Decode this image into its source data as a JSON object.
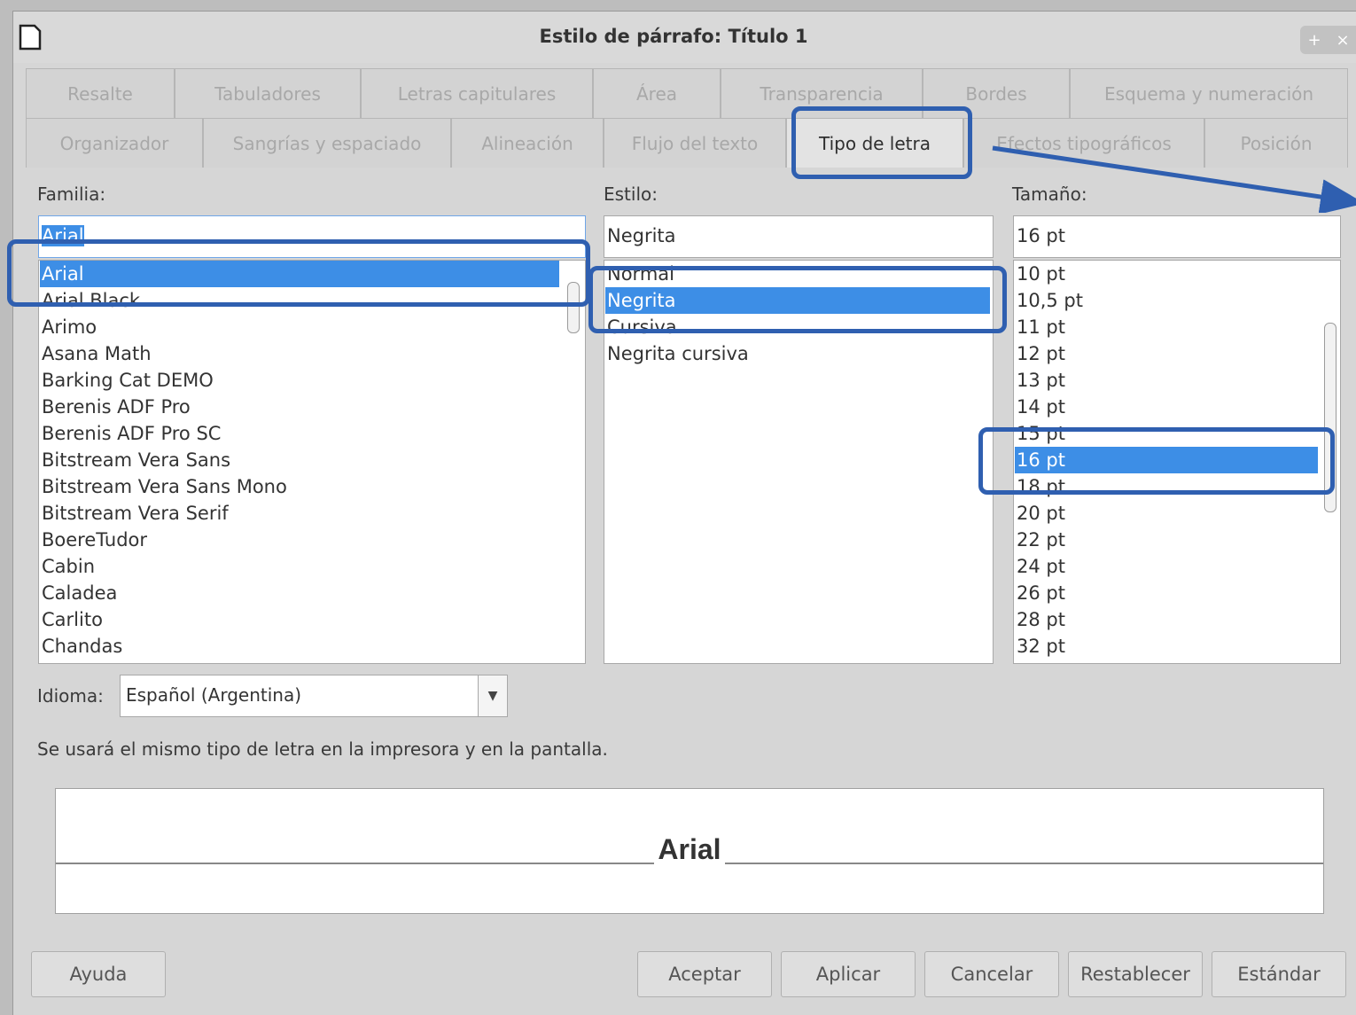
{
  "dialog": {
    "title": "Estilo de párrafo: Título 1",
    "window_buttons": [
      "+",
      "×"
    ]
  },
  "tabs_row1": [
    "Resalte",
    "Tabuladores",
    "Letras capitulares",
    "Área",
    "Transparencia",
    "Bordes",
    "Esquema y numeración"
  ],
  "tabs_row2": [
    "Organizador",
    "Sangrías y espaciado",
    "Alineación",
    "Flujo del texto",
    "Tipo de letra",
    "Efectos tipográficos",
    "Posición"
  ],
  "active_tab": "Tipo de letra",
  "family": {
    "label": "Familia:",
    "value": "Arial",
    "items": [
      "Arial",
      "Arial Black",
      "Arimo",
      "Asana Math",
      "Barking Cat DEMO",
      "Berenis ADF Pro",
      "Berenis ADF Pro SC",
      "Bitstream Vera Sans",
      "Bitstream Vera Sans Mono",
      "Bitstream Vera Serif",
      "BoereTudor",
      "Cabin",
      "Caladea",
      "Carlito",
      "Chandas"
    ],
    "selected": "Arial"
  },
  "style": {
    "label": "Estilo:",
    "value": "Negrita",
    "items": [
      "Normal",
      "Negrita",
      "Cursiva",
      "Negrita cursiva"
    ],
    "selected": "Negrita"
  },
  "size": {
    "label": "Tamaño:",
    "value": "16 pt",
    "items": [
      "10 pt",
      "10,5 pt",
      "11 pt",
      "12 pt",
      "13 pt",
      "14 pt",
      "15 pt",
      "16 pt",
      "18 pt",
      "20 pt",
      "22 pt",
      "24 pt",
      "26 pt",
      "28 pt",
      "32 pt"
    ],
    "selected": "16 pt"
  },
  "language": {
    "label": "Idioma:",
    "value": "Español (Argentina)"
  },
  "note": "Se usará el mismo tipo de letra en la impresora y en la pantalla.",
  "preview_text": "Arial",
  "buttons": {
    "help": "Ayuda",
    "ok": "Aceptar",
    "apply": "Aplicar",
    "cancel": "Cancelar",
    "reset": "Restablecer",
    "standard": "Estándar"
  },
  "colors": {
    "selection": "#3d8ee6",
    "callout": "#2f5fb0"
  }
}
